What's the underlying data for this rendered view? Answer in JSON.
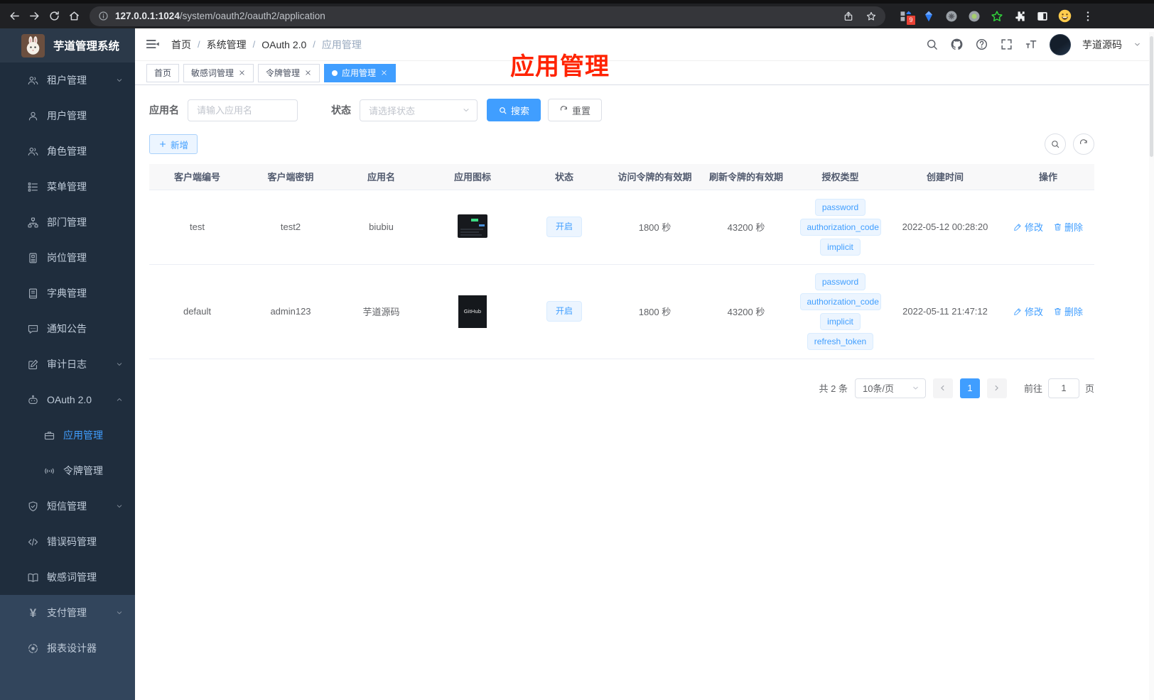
{
  "colors": {
    "accent": "#409eff",
    "annotation_red": "#ff2301",
    "sidebar_dark": "#1f2d3d",
    "sidebar_light": "#32455c"
  },
  "browser": {
    "url_host": "127.0.0.1:1024",
    "url_path": "/system/oauth2/oauth2/application",
    "extension_badge": "9"
  },
  "sidebar": {
    "title": "芋道管理系统",
    "items": [
      {
        "label": "租户管理",
        "icon": "users-icon",
        "arrow": "down"
      },
      {
        "label": "用户管理",
        "icon": "user-icon"
      },
      {
        "label": "角色管理",
        "icon": "roles-icon"
      },
      {
        "label": "菜单管理",
        "icon": "menu-tree-icon"
      },
      {
        "label": "部门管理",
        "icon": "org-icon"
      },
      {
        "label": "岗位管理",
        "icon": "badge-icon"
      },
      {
        "label": "字典管理",
        "icon": "dictionary-icon"
      },
      {
        "label": "通知公告",
        "icon": "announcement-icon"
      },
      {
        "label": "审计日志",
        "icon": "audit-log-icon",
        "arrow": "down"
      },
      {
        "label": "OAuth 2.0",
        "icon": "robot-icon",
        "arrow": "up"
      },
      {
        "label": "应用管理",
        "icon": "briefcase-icon",
        "indent": true,
        "active": true
      },
      {
        "label": "令牌管理",
        "icon": "token-icon",
        "indent": true
      },
      {
        "label": "短信管理",
        "icon": "shield-icon",
        "arrow": "down"
      },
      {
        "label": "错误码管理",
        "icon": "code-icon"
      },
      {
        "label": "敏感词管理",
        "icon": "open-book-icon"
      },
      {
        "label": "支付管理",
        "icon": "yen-icon",
        "arrow": "down",
        "light": true
      },
      {
        "label": "报表设计器",
        "icon": "report-icon",
        "light": true
      }
    ]
  },
  "navbar": {
    "breadcrumb": [
      "首页",
      "系统管理",
      "OAuth 2.0",
      "应用管理"
    ],
    "separator": "/",
    "user_name": "芋道源码"
  },
  "tabs": [
    {
      "label": "首页",
      "closable": false,
      "active": false
    },
    {
      "label": "敏感词管理",
      "closable": true,
      "active": false
    },
    {
      "label": "令牌管理",
      "closable": true,
      "active": false
    },
    {
      "label": "应用管理",
      "closable": true,
      "active": true
    }
  ],
  "annotation": {
    "text": "应用管理"
  },
  "filters": {
    "app_name_label": "应用名",
    "app_name_placeholder": "请输入应用名",
    "status_label": "状态",
    "status_placeholder": "请选择状态",
    "search_label": "搜索",
    "reset_label": "重置"
  },
  "toolbar": {
    "add_label": "新增"
  },
  "table": {
    "columns": [
      "客户端编号",
      "客户端密钥",
      "应用名",
      "应用图标",
      "状态",
      "访问令牌的有效期",
      "刷新令牌的有效期",
      "授权类型",
      "创建时间",
      "操作"
    ],
    "edit_label": "修改",
    "delete_label": "删除",
    "rows": [
      {
        "client_id": "test",
        "client_secret": "test2",
        "app_name": "biubiu",
        "icon_type": "terminal-screenshot",
        "icon_text": "",
        "status": "开启",
        "access_token_validity": "1800 秒",
        "refresh_token_validity": "43200 秒",
        "grant_types": [
          "password",
          "authorization_code",
          "implicit"
        ],
        "created_at": "2022-05-12 00:28:20"
      },
      {
        "client_id": "default",
        "client_secret": "admin123",
        "app_name": "芋道源码",
        "icon_type": "github-dark",
        "icon_text": "GitHub",
        "status": "开启",
        "access_token_validity": "1800 秒",
        "refresh_token_validity": "43200 秒",
        "grant_types": [
          "password",
          "authorization_code",
          "implicit",
          "refresh_token"
        ],
        "created_at": "2022-05-11 21:47:12"
      }
    ]
  },
  "pagination": {
    "total_label": "共 2 条",
    "page_size": "10条/页",
    "current_page": "1",
    "goto_label": "前往",
    "goto_value": "1",
    "unit_label": "页"
  }
}
